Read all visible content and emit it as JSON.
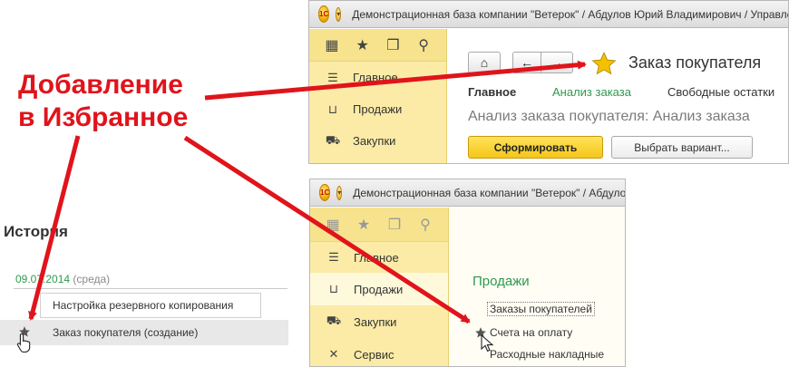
{
  "callout": {
    "line1": "Добавление",
    "line2": "в Избранное",
    "color": "#e0141b"
  },
  "history": {
    "title": "История",
    "date": "09.07.2014",
    "weekday": "(среда)",
    "items": [
      {
        "label": "Настройка резервного копирования",
        "selected": false
      },
      {
        "label": "Заказ покупателя (создание)",
        "selected": true
      }
    ]
  },
  "window_top": {
    "title": "Демонстрационная база компании \"Ветерок\" / Абдулов Юрий Владимирович / Управлени",
    "logo_text": "1С",
    "sidebar": [
      "Главное",
      "Продажи",
      "Закупки"
    ],
    "page_title": "Заказ покупателя",
    "tabs": [
      "Главное",
      "Анализ заказа",
      "Свободные остатки"
    ],
    "report_title": "Анализ заказа покупателя: Анализ заказа",
    "generate_button": "Сформировать",
    "variant_button": "Выбрать вариант..."
  },
  "window_bottom": {
    "title": "Демонстрационная база компании \"Ветерок\" / Абдулов",
    "logo_text": "1С",
    "sidebar": [
      "Главное",
      "Продажи",
      "Закупки",
      "Сервис"
    ],
    "section_title": "Продажи",
    "links": [
      "Заказы покупателей",
      "Счета на оплату",
      "Расходные накладные"
    ]
  },
  "icons": {
    "grid": "grid-icon",
    "star": "star-icon",
    "history": "history-icon",
    "search": "search-icon",
    "menu": "menu-icon",
    "basket": "basket-icon",
    "cart": "cart-icon",
    "tools": "tools-icon",
    "home": "home-icon",
    "back": "arrow-left-icon",
    "forward": "arrow-right-icon"
  },
  "colors": {
    "sidebar": "#fbeba6",
    "accent_green": "#2e9a4e",
    "favorite_star": "#f2c200",
    "generate_button": "#f5c61a"
  }
}
